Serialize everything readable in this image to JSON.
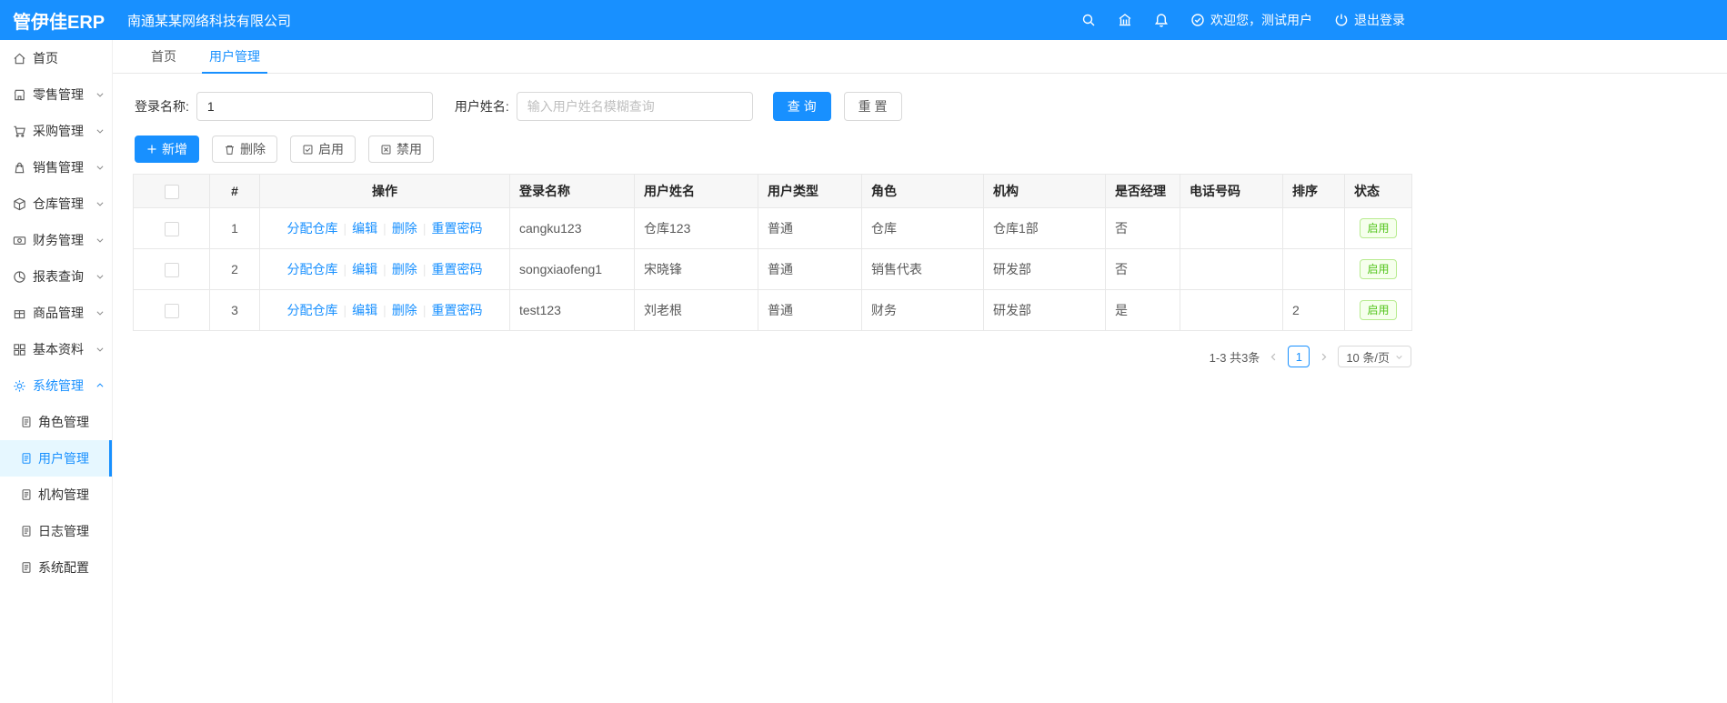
{
  "header": {
    "logo": "管伊佳ERP",
    "company": "南通某某网络科技有限公司",
    "welcome": "欢迎您，测试用户",
    "logout": "退出登录"
  },
  "sidebar": {
    "items": [
      {
        "label": "首页",
        "icon": "home"
      },
      {
        "label": "零售管理",
        "icon": "retail"
      },
      {
        "label": "采购管理",
        "icon": "purchase"
      },
      {
        "label": "销售管理",
        "icon": "sales"
      },
      {
        "label": "仓库管理",
        "icon": "warehouse"
      },
      {
        "label": "财务管理",
        "icon": "finance"
      },
      {
        "label": "报表查询",
        "icon": "report"
      },
      {
        "label": "商品管理",
        "icon": "goods"
      },
      {
        "label": "基本资料",
        "icon": "basic-data"
      },
      {
        "label": "系统管理",
        "icon": "system-gear"
      }
    ],
    "system_children": [
      {
        "label": "角色管理"
      },
      {
        "label": "用户管理"
      },
      {
        "label": "机构管理"
      },
      {
        "label": "日志管理"
      },
      {
        "label": "系统配置"
      }
    ]
  },
  "tabs": [
    {
      "label": "首页"
    },
    {
      "label": "用户管理"
    }
  ],
  "search": {
    "login_label": "登录名称:",
    "login_value": "1",
    "name_label": "用户姓名:",
    "name_placeholder": "输入用户姓名模糊查询",
    "query_label": "查 询",
    "reset_label": "重 置"
  },
  "toolbar": {
    "add": "新增",
    "delete": "删除",
    "enable": "启用",
    "disable": "禁用"
  },
  "table": {
    "headers": [
      "#",
      "操作",
      "登录名称",
      "用户姓名",
      "用户类型",
      "角色",
      "机构",
      "是否经理",
      "电话号码",
      "排序",
      "状态"
    ],
    "op_links": [
      "分配仓库",
      "编辑",
      "删除",
      "重置密码"
    ],
    "op_sep": "|",
    "rows": [
      {
        "index": "1",
        "login": "cangku123",
        "name": "仓库123",
        "type": "普通",
        "role": "仓库",
        "org": "仓库1部",
        "manager": "否",
        "phone": "",
        "sort": "",
        "status": "启用"
      },
      {
        "index": "2",
        "login": "songxiaofeng1",
        "name": "宋晓锋",
        "type": "普通",
        "role": "销售代表",
        "org": "研发部",
        "manager": "否",
        "phone": "",
        "sort": "",
        "status": "启用"
      },
      {
        "index": "3",
        "login": "test123",
        "name": "刘老根",
        "type": "普通",
        "role": "财务",
        "org": "研发部",
        "manager": "是",
        "phone": "",
        "sort": "2",
        "status": "启用"
      }
    ]
  },
  "pagination": {
    "total_text": "1-3 共3条",
    "current_page": "1",
    "page_size": "10 条/页"
  },
  "colors": {
    "primary": "#1890ff",
    "success": "#52c41a"
  }
}
